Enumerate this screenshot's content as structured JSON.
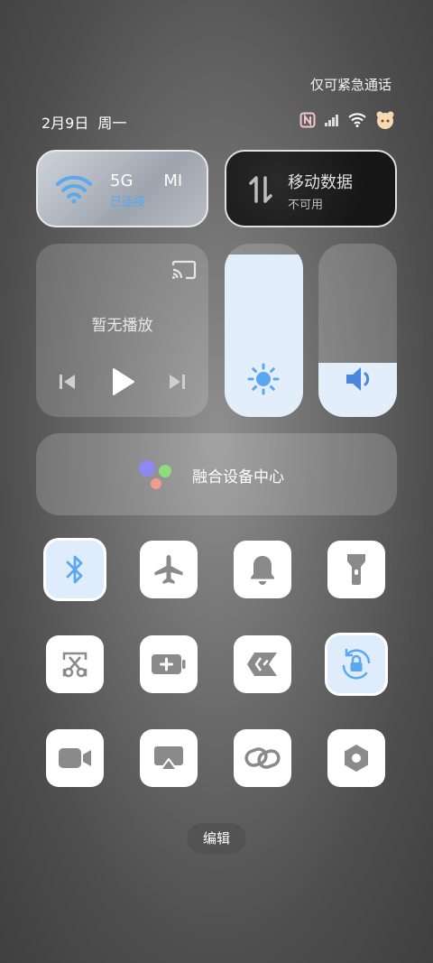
{
  "status_bar": {
    "emergency_text": "仅可紧急通话",
    "date": "2月9日",
    "weekday": "周一",
    "icons": [
      "nfc-icon",
      "signal-icon",
      "wifi-icon",
      "avatar-icon"
    ]
  },
  "wifi_tile": {
    "title": "5G",
    "name_suffix": "MI",
    "status": "已连接"
  },
  "data_tile": {
    "title": "移动数据",
    "status": "不可用"
  },
  "media": {
    "label": "暂无播放",
    "controls": [
      "previous-icon",
      "play-icon",
      "next-icon"
    ]
  },
  "brightness": {
    "level": 0.94,
    "icon": "sun-icon"
  },
  "volume": {
    "level": 0.31,
    "icon": "speaker-icon"
  },
  "fusion": {
    "label": "融合设备中心"
  },
  "toggles": [
    {
      "icon": "bluetooth-icon",
      "active": true
    },
    {
      "icon": "airplane-icon",
      "active": false
    },
    {
      "icon": "bell-icon",
      "active": false
    },
    {
      "icon": "flashlight-icon",
      "active": false
    },
    {
      "icon": "screenshot-scissors-icon",
      "active": false
    },
    {
      "icon": "battery-saver-icon",
      "active": false
    },
    {
      "icon": "shortcut-icon",
      "active": false
    },
    {
      "icon": "rotation-lock-icon",
      "active": true
    },
    {
      "icon": "video-icon",
      "active": false
    },
    {
      "icon": "screen-cast-icon",
      "active": false
    },
    {
      "icon": "link-icon",
      "active": false
    },
    {
      "icon": "nut-icon",
      "active": false
    }
  ],
  "edit_label": "编辑",
  "colors": {
    "active_blue": "#5aa9f0",
    "icon_gray": "#8a8a8a",
    "fill_blue": "#e3eefb"
  }
}
